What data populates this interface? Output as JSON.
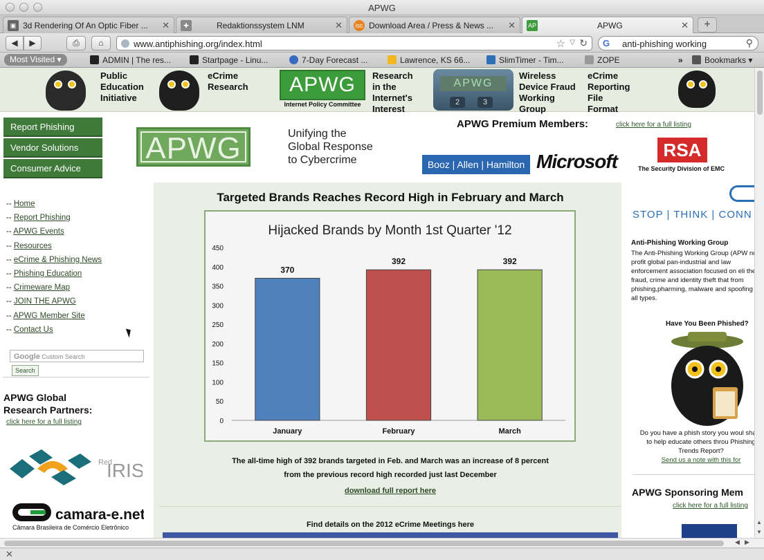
{
  "window": {
    "title": "APWG"
  },
  "tabs": [
    {
      "label": "3d Rendering Of An Optic Fiber ...",
      "icon": "page-icon",
      "active": false
    },
    {
      "label": "Redaktionssystem LNM",
      "icon": "plugin-icon",
      "active": false
    },
    {
      "label": "Download Area / Press & News ...",
      "icon": "isc-icon",
      "active": false
    },
    {
      "label": "APWG",
      "icon": "apwg-icon",
      "active": true
    }
  ],
  "toolbar": {
    "url": "www.antiphishing.org/index.html",
    "search_value": "anti-phishing working",
    "search_engine_glyph": "G"
  },
  "bookmarks": {
    "most_visited": "Most Visited",
    "items": [
      {
        "label": "ADMIN | The res...",
        "icon": "A"
      },
      {
        "label": "Startpage - Linu...",
        "icon": "L"
      },
      {
        "label": "7-Day Forecast ...",
        "icon": "weather"
      },
      {
        "label": "Lawrence, KS 66...",
        "icon": "sun"
      },
      {
        "label": "SlimTimer - Tim...",
        "icon": "St"
      },
      {
        "label": "ZOPE",
        "icon": "plugin"
      }
    ],
    "overflow": "»",
    "bookmarks_menu": "Bookmarks"
  },
  "banner": {
    "public_education": "Public\nEducation\nInitiative",
    "ecrime_research": "eCrime\nResearch",
    "ipc_logo": "APWG",
    "ipc_caption": "Internet Policy Committee",
    "research_interest": "Research\nin the\nInternet's\nInterest",
    "calc_screen": "APWG",
    "calc_keys": [
      "2",
      "3"
    ],
    "wireless": "Wireless\nDevice Fraud\nWorking\nGroup",
    "ecrime_reporting": "eCrime\nReporting\nFile\nFormat"
  },
  "header": {
    "nav_buttons": [
      "Report Phishing",
      "Vendor Solutions",
      "Consumer Advice"
    ],
    "logo": "APWG",
    "tagline": "Unifying the\nGlobal Response\nto Cybercrime",
    "premium_title": "APWG Premium Members:",
    "premium_link": "click here for a full listing",
    "members": {
      "booz": "Booz | Allen | Hamilton",
      "microsoft": "Microsoft",
      "rsa": "RSA",
      "rsa_sub": "The Security Division of EMC"
    }
  },
  "sidebar": {
    "prefix": "-- ",
    "links": [
      "Home",
      "Report Phishing",
      "APWG Events",
      "Resources",
      "eCrime & Phishing News",
      "Phishing Education",
      "Crimeware Map",
      "JOIN THE APWG",
      "APWG Member Site",
      "Contact Us"
    ],
    "search_placeholder_brand": "Google",
    "search_placeholder": "Custom Search",
    "search_button": "Search",
    "partners_title": "APWG Global\nResearch Partners:",
    "partners_link": "click here for a full listing",
    "rediris_top": "Red",
    "rediris_main": "IRIS",
    "camara_main": "camara-e.net",
    "camara_sub": "Câmara Brasileira de Comércio Eletrônico"
  },
  "main": {
    "headline": "Targeted Brands Reaches Record High in February and March",
    "caption": "The all-time high of 392 brands targeted in Feb. and March was an increase of 8 percent\nfrom the previous record high recorded just last December",
    "download_link": "download full report here",
    "meetings": "Find details on the 2012 eCrime Meetings here"
  },
  "chart_data": {
    "type": "bar",
    "title": "Hijacked Brands by Month 1st Quarter '12",
    "categories": [
      "January",
      "February",
      "March"
    ],
    "values": [
      370,
      392,
      392
    ],
    "data_labels": [
      "370",
      "392",
      "392"
    ],
    "colors": [
      "#4f81bd",
      "#c0504d",
      "#9bbb59"
    ],
    "ylim": [
      0,
      450
    ],
    "yticks": [
      0,
      50,
      100,
      150,
      200,
      250,
      300,
      350,
      400,
      450
    ],
    "xlabel": "",
    "ylabel": "",
    "grid": false,
    "legend": "none"
  },
  "right": {
    "stop_think_connect": "STOP | THINK | CONN",
    "group_title": "Anti-Phishing Working Group",
    "group_desc": "The Anti-Phishing Working Group (APW non-profit global pan-industrial and law enforcement association focused on eli the fraud, crime and identity theft that from phishing,pharming, malware and spoofing of all types.",
    "phished_title": "Have You Been Phished?",
    "phish_desc": "Do you have a phish story you woul share to help educate others throu Phishing Trends Report?",
    "phish_link": "Send us a note with this for",
    "sponsor_title": "APWG Sponsoring Mem",
    "sponsor_link": "click here for a full listing"
  }
}
